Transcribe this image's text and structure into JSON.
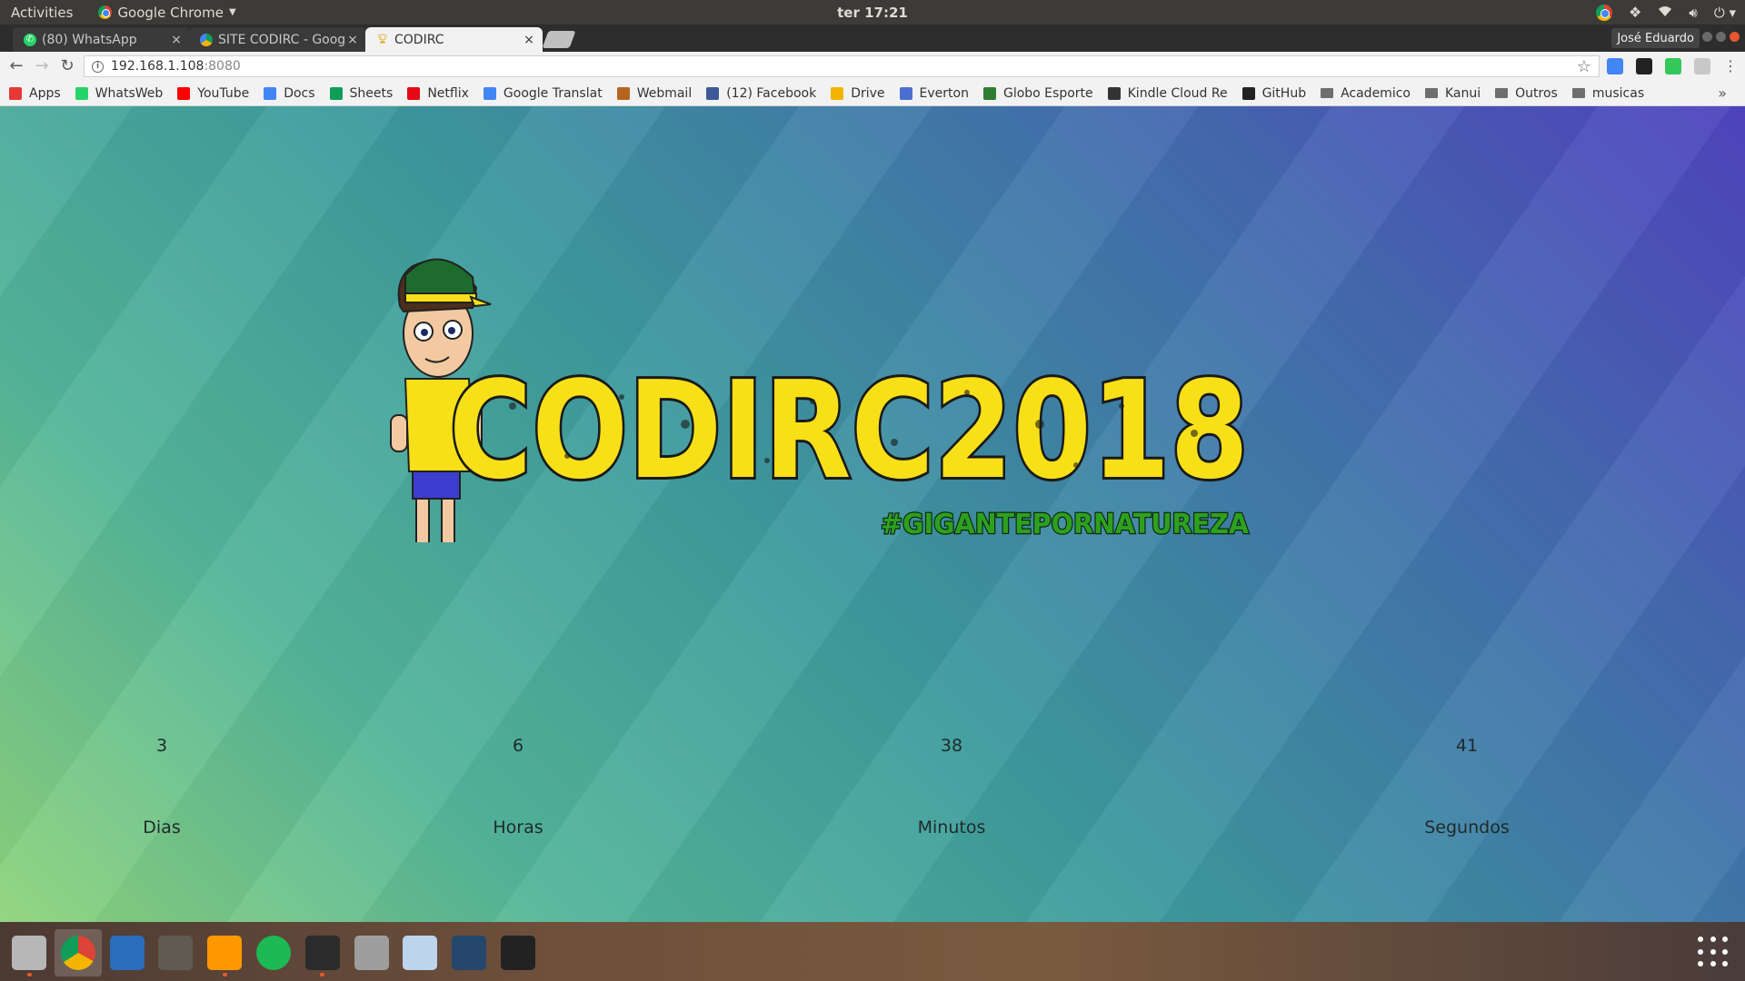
{
  "topbar": {
    "activities": "Activities",
    "app_menu": "Google Chrome",
    "clock": "ter 17:21"
  },
  "tabs": [
    {
      "title": "(80) WhatsApp",
      "icon": "whatsapp-icon",
      "active": false
    },
    {
      "title": "SITE CODIRC - Goog",
      "icon": "google-drive-icon",
      "active": false
    },
    {
      "title": "CODIRC",
      "icon": "trophy-icon",
      "active": true
    }
  ],
  "profile": "José Eduardo",
  "omnibox": {
    "host": "192.168.1.108",
    "port": ":8080"
  },
  "bookmarks": [
    {
      "label": "Apps",
      "icon": "apps-grid-icon",
      "color": "#e53935"
    },
    {
      "label": "WhatsWeb",
      "icon": "whatsapp-icon",
      "color": "#25d366"
    },
    {
      "label": "YouTube",
      "icon": "youtube-icon",
      "color": "#ff0000"
    },
    {
      "label": "Docs",
      "icon": "docs-icon",
      "color": "#4285f4"
    },
    {
      "label": "Sheets",
      "icon": "sheets-icon",
      "color": "#0f9d58"
    },
    {
      "label": "Netflix",
      "icon": "netflix-icon",
      "color": "#e50914"
    },
    {
      "label": "Google Translat",
      "icon": "translate-icon",
      "color": "#4285f4"
    },
    {
      "label": "Webmail",
      "icon": "webmail-icon",
      "color": "#b5651d"
    },
    {
      "label": "(12) Facebook",
      "icon": "facebook-icon",
      "color": "#3b5998"
    },
    {
      "label": "Drive",
      "icon": "drive-icon",
      "color": "#f4b400"
    },
    {
      "label": "Everton",
      "icon": "calendar-icon",
      "color": "#4a6fd0"
    },
    {
      "label": "Globo Esporte",
      "icon": "ge-icon",
      "color": "#2e7d32"
    },
    {
      "label": "Kindle Cloud Re",
      "icon": "kindle-icon",
      "color": "#333333"
    },
    {
      "label": "GitHub",
      "icon": "github-icon",
      "color": "#222222"
    },
    {
      "label": "Academico",
      "icon": "folder-icon",
      "folder": true
    },
    {
      "label": "Kanui",
      "icon": "folder-icon",
      "folder": true
    },
    {
      "label": "Outros",
      "icon": "folder-icon",
      "folder": true
    },
    {
      "label": "musicas",
      "icon": "folder-icon",
      "folder": true
    }
  ],
  "logo": {
    "title": "CODIRC2018",
    "hashtag": "#GIGANTEPORNATUREZA",
    "title_color": "#f7e017",
    "hashtag_color": "#2ea01f"
  },
  "countdown": [
    {
      "value": "3",
      "label": "Dias"
    },
    {
      "value": "6",
      "label": "Horas"
    },
    {
      "value": "38",
      "label": "Minutos"
    },
    {
      "value": "41",
      "label": "Segundos"
    }
  ],
  "dock": [
    {
      "name": "files-icon",
      "active": false,
      "running": true
    },
    {
      "name": "chrome-icon",
      "active": true,
      "running": false
    },
    {
      "name": "writer-icon",
      "active": false,
      "running": false
    },
    {
      "name": "gimp-icon",
      "active": false,
      "running": false
    },
    {
      "name": "sublime-text-icon",
      "active": false,
      "running": true
    },
    {
      "name": "spotify-icon",
      "active": false,
      "running": false
    },
    {
      "name": "terminal-icon",
      "active": false,
      "running": true
    },
    {
      "name": "calculator-icon",
      "active": false,
      "running": false
    },
    {
      "name": "cube-icon",
      "active": false,
      "running": false
    },
    {
      "name": "mysql-workbench-icon",
      "active": false,
      "running": false
    },
    {
      "name": "inkscape-icon",
      "active": false,
      "running": false
    }
  ]
}
